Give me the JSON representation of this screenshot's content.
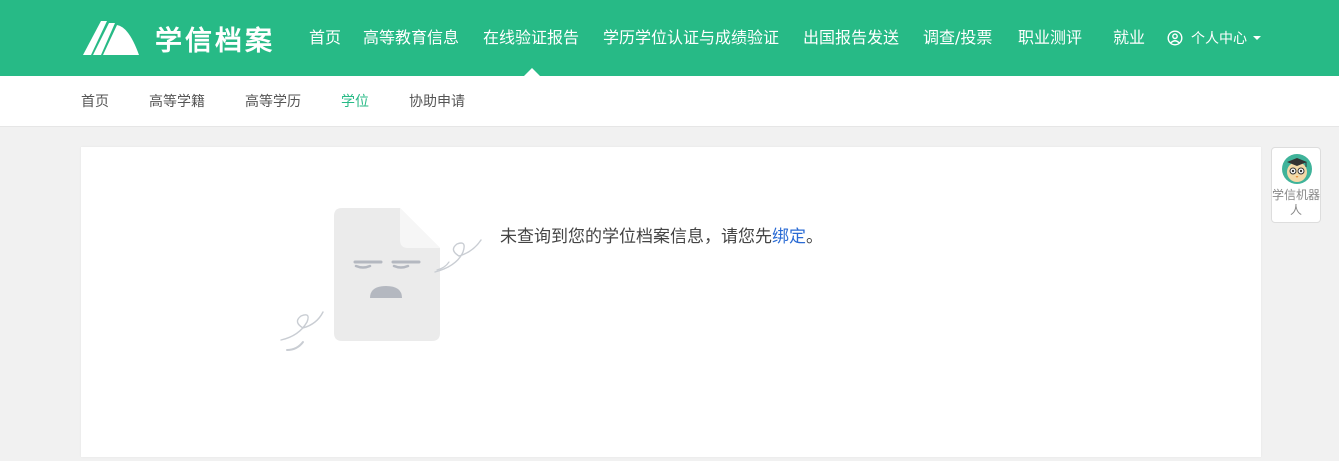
{
  "header": {
    "logo_text": "学信档案",
    "nav": [
      {
        "label": "首页"
      },
      {
        "label": "高等教育信息"
      },
      {
        "label": "在线验证报告"
      },
      {
        "label": "学历学位认证与成绩验证"
      },
      {
        "label": "出国报告发送"
      },
      {
        "label": "调查/投票"
      },
      {
        "label": "职业测评"
      },
      {
        "label": "就业"
      }
    ],
    "active_nav": "在线验证报告",
    "user_center_label": "个人中心"
  },
  "subnav": {
    "items": [
      {
        "label": "首页"
      },
      {
        "label": "高等学籍"
      },
      {
        "label": "高等学历"
      },
      {
        "label": "学位"
      },
      {
        "label": "协助申请"
      }
    ],
    "active_item": "学位"
  },
  "main": {
    "message_prefix": "未查询到您的学位档案信息，请您先",
    "bind_link_text": "绑定",
    "message_suffix": "。"
  },
  "robot": {
    "label": "学信机器人"
  },
  "colors": {
    "brand": "#27ba86",
    "link": "#2a6bd4",
    "page_background": "#f1f1f1"
  },
  "icons": {
    "logo": "book-logo-icon",
    "user": "user-circle-icon",
    "empty_state": "sad-document-icon",
    "robot": "robot-avatar-icon"
  }
}
